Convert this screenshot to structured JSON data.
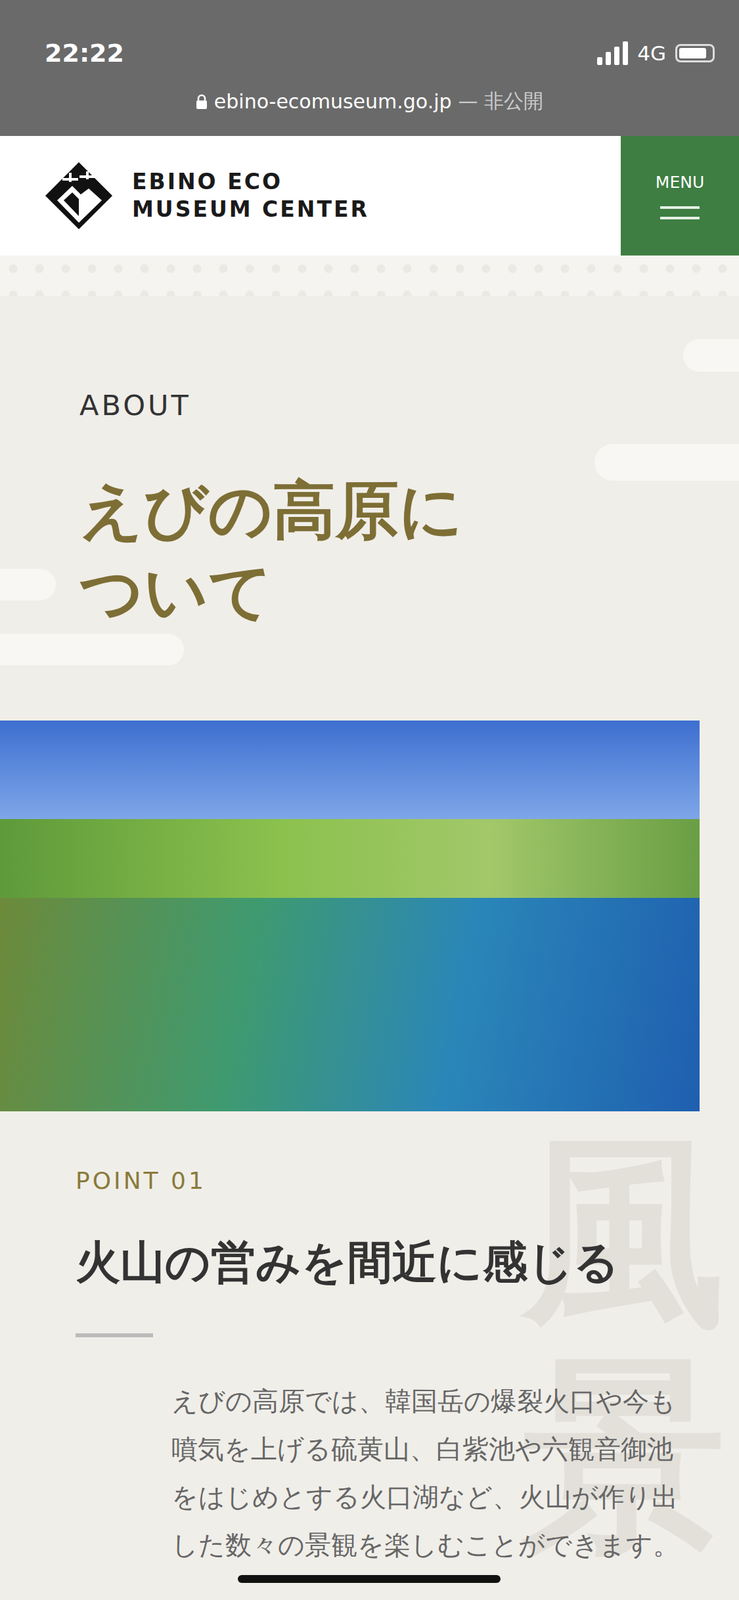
{
  "status_bar": {
    "time": "22:22",
    "network": "4G",
    "signal_level": 1,
    "battery_level": 0.85
  },
  "address_bar": {
    "url": "ebino-ecomuseum.go.jp",
    "suffix": "— 非公開"
  },
  "header": {
    "logo_lines": [
      "EBINO ECO",
      "MUSEUM CENTER"
    ],
    "menu_label": "MENU"
  },
  "about": {
    "eyebrow": "ABOUT",
    "title_lines": [
      "えびの高原に",
      "ついて"
    ]
  },
  "point": {
    "label": "POINT 01",
    "heading": "火山の営みを間近に感じる",
    "body": "えびの高原では、韓国岳の爆裂火口や今も噴気を上げる硫黄山、白紫池や六観音御池をはじめとする火口湖など、火山が作り出した数々の景観を楽しむことができます。"
  },
  "watermark": "風景"
}
